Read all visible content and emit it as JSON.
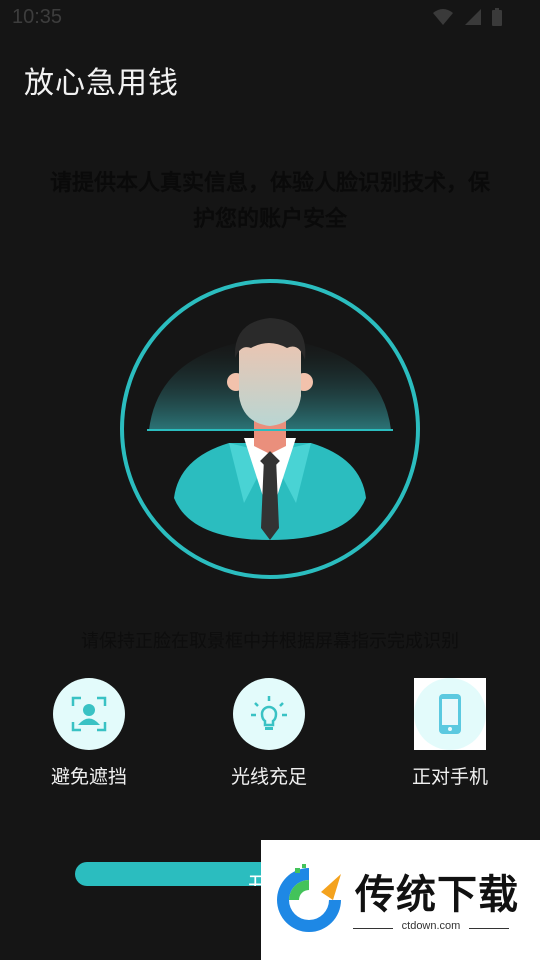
{
  "status": {
    "time": "10:35"
  },
  "header": {
    "title": "放心急用钱"
  },
  "intro": {
    "text": "请提供本人真实信息，体验人脸识别技术，保护您的账户安全"
  },
  "hint": {
    "text": "请保持正脸在取景框中并根据屏幕指示完成识别"
  },
  "tips": [
    {
      "label": "避免遮挡",
      "icon": "face-scan-icon"
    },
    {
      "label": "光线充足",
      "icon": "lightbulb-icon"
    },
    {
      "label": "正对手机",
      "icon": "phone-icon"
    }
  ],
  "action": {
    "start_label": "开始"
  },
  "watermark": {
    "brand": "传统下载",
    "url": "ctdown.com"
  },
  "colors": {
    "accent": "#2bbdbf",
    "background": "#151515",
    "icon_bg": "#e3fbfb"
  }
}
